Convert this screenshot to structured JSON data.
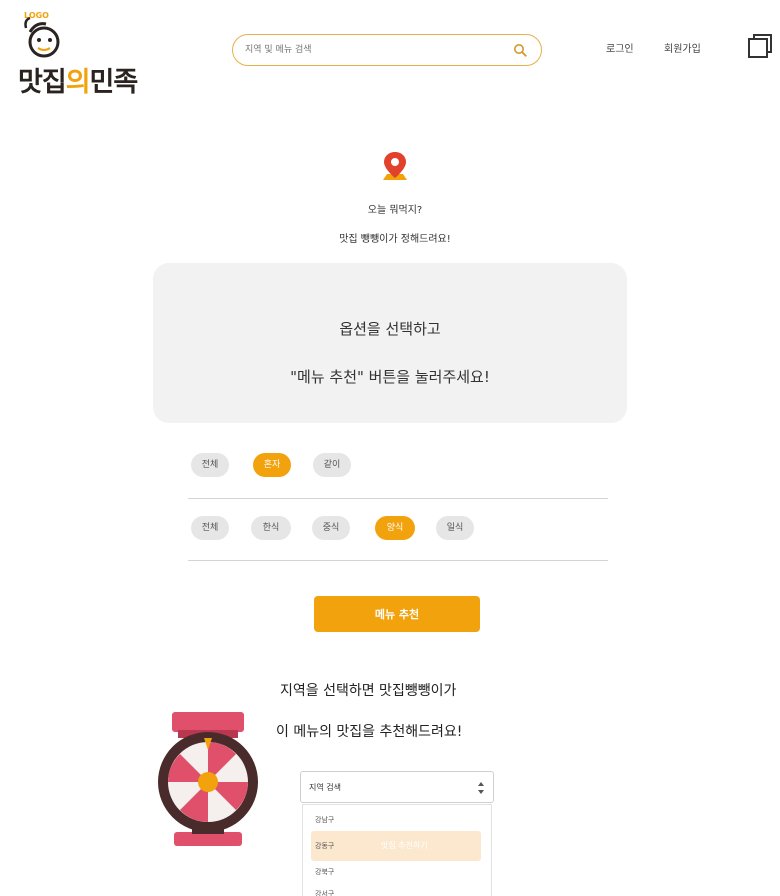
{
  "header": {
    "logo_top": "LOGO",
    "logo_text_a": "맛집",
    "logo_text_b": "의",
    "logo_text_c": "민족",
    "search_placeholder": "지역 및 메뉴 검색",
    "login_label": "로그인",
    "signup_label": "회원가입",
    "icons": {
      "search": "search-icon",
      "cart": "window-icon"
    }
  },
  "intro": {
    "line1": "오늘 뭐먹지?",
    "line2": "맛집 뺑뺑이가 정해드려요!",
    "icon": "location-pin-icon"
  },
  "result": {
    "line1": "옵션을 선택하고",
    "line2": "\"메뉴 추천\" 버튼을 눌러주세요!"
  },
  "filters": {
    "group1": [
      {
        "label": "전체",
        "active": false
      },
      {
        "label": "혼자",
        "active": true
      },
      {
        "label": "같이",
        "active": false
      }
    ],
    "group2": [
      {
        "label": "전체",
        "active": false
      },
      {
        "label": "한식",
        "active": false
      },
      {
        "label": "중식",
        "active": false
      },
      {
        "label": "양식",
        "active": true
      },
      {
        "label": "일식",
        "active": false
      }
    ]
  },
  "recommend_button": "메뉴 추천",
  "bottom": {
    "line1": "지역을 선택하면 맛집뺑뺑이가",
    "line2": "이 메뉴의 맛집을 추천해드려요!",
    "wheel_icon": "roulette-wheel-icon"
  },
  "region": {
    "selected": "지역 검색",
    "options": [
      "강남구",
      "강동구",
      "강북구",
      "강서구"
    ],
    "highlight_text": "맛집 추천하기"
  },
  "colors": {
    "accent": "#f1a20d",
    "chip_bg": "#e6e6e6",
    "box_bg": "#f2f2f2",
    "search_border": "#e8b04a",
    "highlight": "#fbe8cf"
  }
}
